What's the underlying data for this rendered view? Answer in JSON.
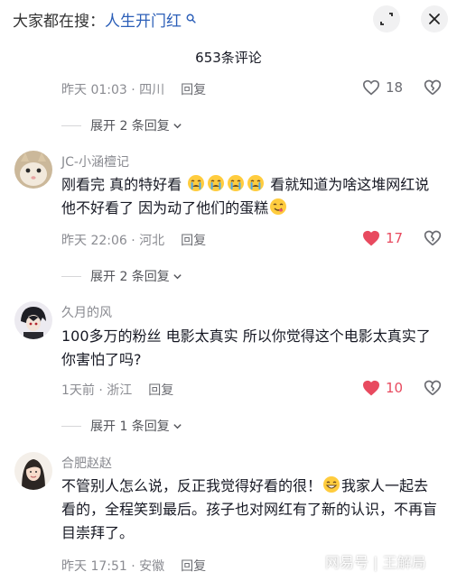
{
  "header": {
    "search_prefix": "大家都在搜：",
    "search_keyword": "人生开门红",
    "title": "653条评论"
  },
  "comments": [
    {
      "meta": "昨天 01:03 · 四川",
      "reply_label": "回复",
      "likes": "18",
      "liked": false,
      "expand_label": "展开 2 条回复"
    },
    {
      "username": "JC-小涵檀记",
      "text_1": "刚看完 真的特好看",
      "text_2": "看就知道为啥这堆网红说他不好看了 因为动了他们的蛋糕",
      "meta": "昨天 22:06 · 河北",
      "reply_label": "回复",
      "likes": "17",
      "liked": true,
      "expand_label": "展开 2 条回复"
    },
    {
      "username": "久月的风",
      "text": "100多万的粉丝 电影太真实 所以你觉得这个电影太真实了 你害怕了吗?",
      "meta": "1天前 · 浙江",
      "reply_label": "回复",
      "likes": "10",
      "liked": true,
      "expand_label": "展开 1 条回复"
    },
    {
      "username": "合肥赵赵",
      "text_1": "不管别人怎么说，反正我觉得好看的很！",
      "text_2": "我家人一起去看的，全程笑到最后。孩子也对网红有了新的认识，不再盲目崇拜了。",
      "meta": "昨天 17:51 · 安徽",
      "reply_label": "回复"
    }
  ],
  "watermark": "网易号 | 王解局",
  "colors": {
    "liked_heart": "#e84a5f",
    "keyword": "#2c5fb8",
    "meta_gray": "#8a8b91"
  },
  "icons": [
    "search-icon",
    "expand-icon",
    "close-icon",
    "heart-icon",
    "broken-heart-icon",
    "chevron-down-icon",
    "crying-emoji-icon",
    "yum-emoji-icon",
    "grin-emoji-icon"
  ]
}
